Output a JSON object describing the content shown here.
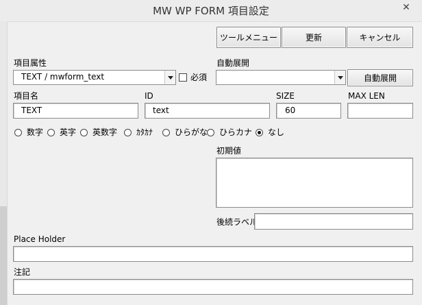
{
  "window": {
    "title": "MW WP FORM 項目設定",
    "close_glyph": "✕"
  },
  "toolbar": {
    "tool_menu_label": "ツールメニュー",
    "update_label": "更新",
    "cancel_label": "キャンセル"
  },
  "item_attribute": {
    "label": "項目属性",
    "selected": "TEXT / mwform_text",
    "required_label": "必須",
    "required_checked": false
  },
  "auto_expand": {
    "label": "自動展開",
    "selected": "",
    "button_label": "自動展開"
  },
  "fields": {
    "name": {
      "label": "項目名",
      "value": "TEXT"
    },
    "id": {
      "label": "ID",
      "value": "text"
    },
    "size": {
      "label": "SIZE",
      "value": "60"
    },
    "maxlen": {
      "label": "MAX LEN",
      "value": ""
    }
  },
  "input_type": {
    "options": [
      {
        "label": "数字",
        "checked": false
      },
      {
        "label": "英字",
        "checked": false
      },
      {
        "label": "英数字",
        "checked": false
      },
      {
        "label": "ｶﾀｶﾅ",
        "checked": false
      },
      {
        "label": "ひらがな",
        "checked": false
      },
      {
        "label": "ひらカナ",
        "checked": false
      },
      {
        "label": "なし",
        "checked": true
      }
    ]
  },
  "initial_value": {
    "label": "初期値",
    "value": ""
  },
  "suffix_label": {
    "label": "後続ラベル",
    "value": ""
  },
  "placeholder": {
    "label": "Place Holder",
    "value": ""
  },
  "note": {
    "label": "注記",
    "value": ""
  }
}
